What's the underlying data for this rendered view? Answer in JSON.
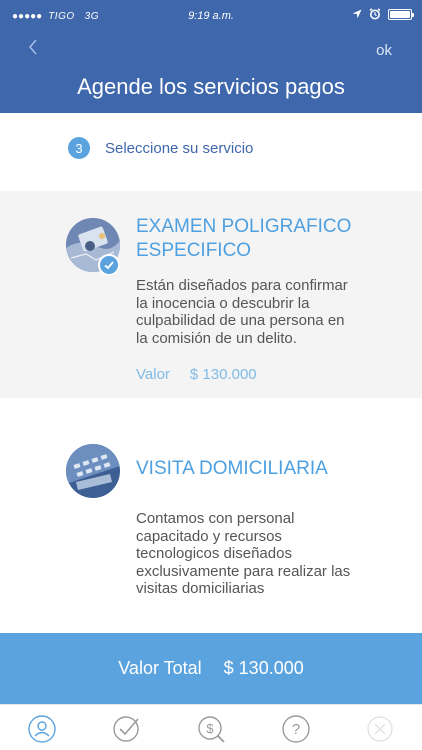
{
  "status_bar": {
    "signal_dots": "●●●●●",
    "carrier": "TIGO",
    "network": "3G",
    "time": "9:19 a.m."
  },
  "header": {
    "back_icon": "chevron-left-icon",
    "ok_label": "ok",
    "title": "Agende los servicios pagos"
  },
  "step": {
    "number": "3",
    "label": "Seleccione su servicio"
  },
  "services": [
    {
      "title_line1": "EXAMEN POLIGRAFICO",
      "title_line2": "ESPECIFICO",
      "desc_line1": "Están diseñados para confirmar",
      "desc_line2": "la inocencia o descubrir la",
      "desc_line3": "culpabilidad de una persona en",
      "desc_line4": "la comisión de un delito.",
      "price_label": "Valor",
      "price_value": "$ 130.000",
      "selected": true
    },
    {
      "title": "VISITA DOMICILIARIA",
      "desc_line1": "Contamos con personal",
      "desc_line2": "capacitado y recursos",
      "desc_line3": "tecnologicos diseñados",
      "desc_line4": "exclusivamente para realizar las",
      "desc_line5": "visitas domiciliarias",
      "selected": false
    }
  ],
  "total": {
    "label": "Valor Total",
    "amount": "$ 130.000"
  },
  "tabbar": {
    "tabs": [
      {
        "icon": "user-icon",
        "active": true
      },
      {
        "icon": "checkmark-icon",
        "active": false
      },
      {
        "icon": "money-search-icon",
        "active": false
      },
      {
        "icon": "help-icon",
        "active": false
      },
      {
        "icon": "close-icon",
        "active": false,
        "disabled": true
      }
    ]
  },
  "colors": {
    "header_bg": "#3f67ac",
    "accent": "#5ba3df",
    "title_blue": "#4ea0e0",
    "selected_card_bg": "#f4f4f4"
  }
}
